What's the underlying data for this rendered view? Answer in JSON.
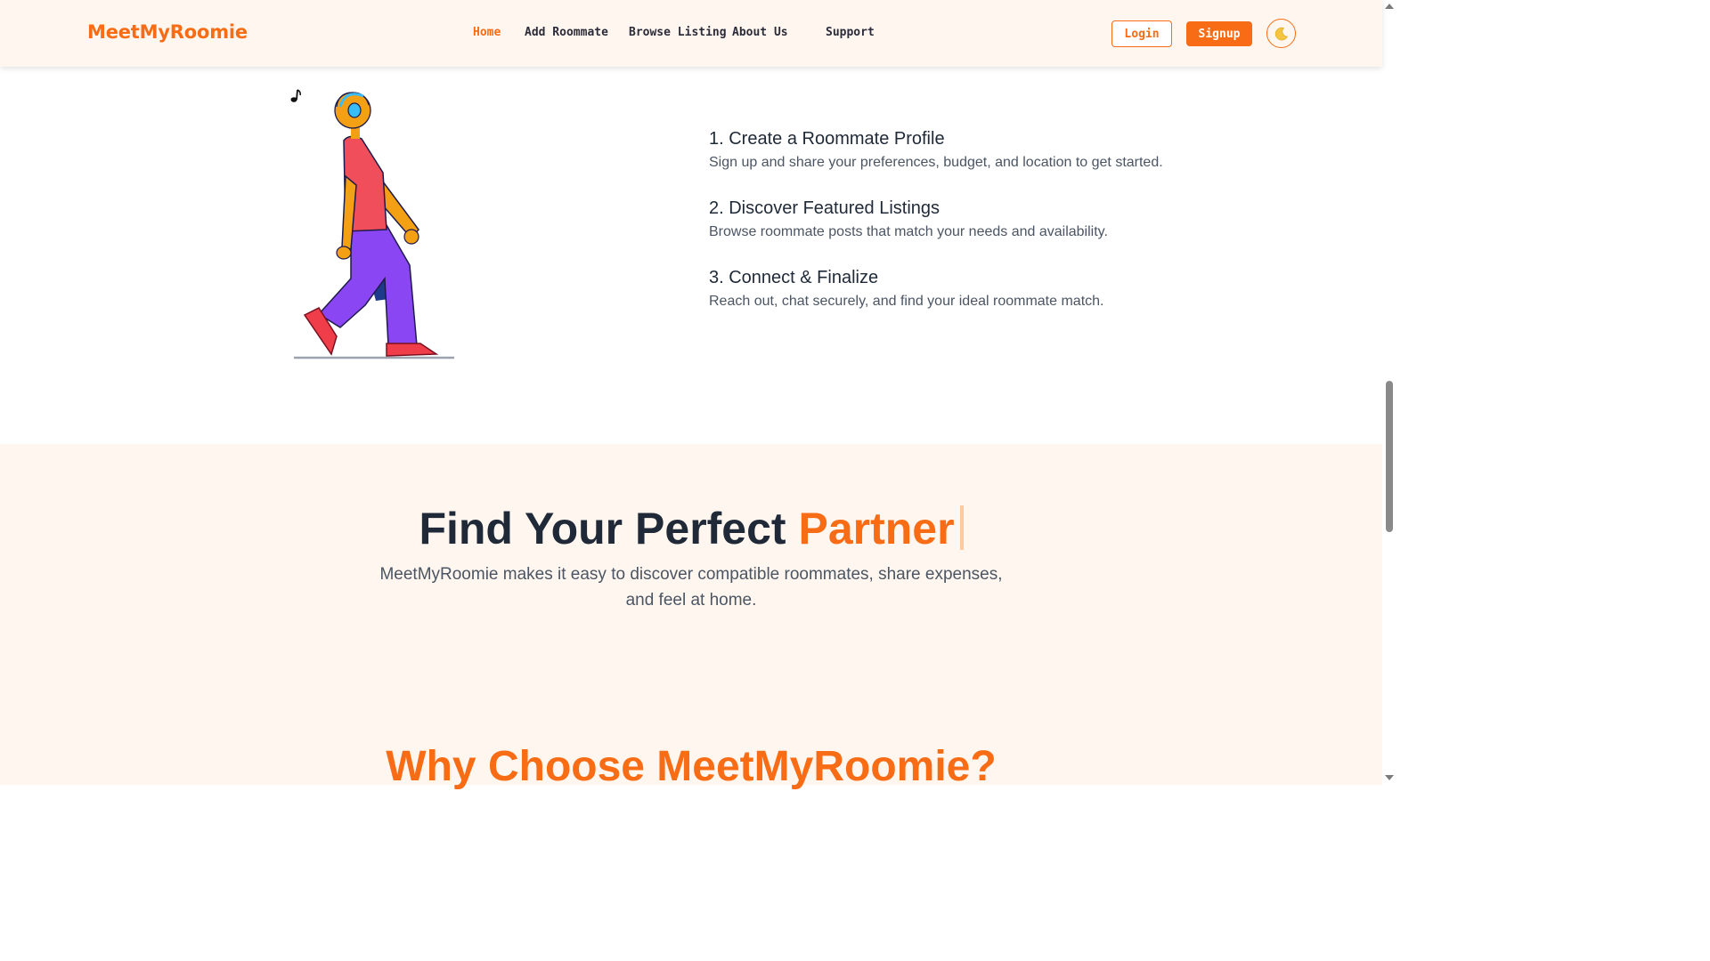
{
  "brand": {
    "name": "MeetMyRoomie",
    "accent_color": "#f86c15"
  },
  "nav": {
    "items": [
      {
        "label": "Home",
        "active": true
      },
      {
        "label": "Add Roommate",
        "active": false
      },
      {
        "label": "Browse Listing",
        "active": false
      },
      {
        "label": "About Us",
        "active": false
      },
      {
        "label": "Support",
        "active": false
      }
    ],
    "login_label": "Login",
    "signup_label": "Signup",
    "theme_icon": "moon-icon"
  },
  "steps": [
    {
      "title": "1. Create a Roommate Profile",
      "description": "Sign up and share your preferences, budget, and location to get started."
    },
    {
      "title": "2. Discover Featured Listings",
      "description": "Browse roommate posts that match your needs and availability."
    },
    {
      "title": "3. Connect & Finalize",
      "description": "Reach out, chat securely, and find your ideal roommate match."
    }
  ],
  "illustration": {
    "subject": "walking-person-with-headphones"
  },
  "hero": {
    "title_prefix": "Find Your Perfect",
    "title_accent": "Partner",
    "subtitle": "MeetMyRoomie makes it easy to discover compatible roommates, share expenses, and feel at home."
  },
  "why_section": {
    "title": "Why Choose MeetMyRoomie?"
  }
}
